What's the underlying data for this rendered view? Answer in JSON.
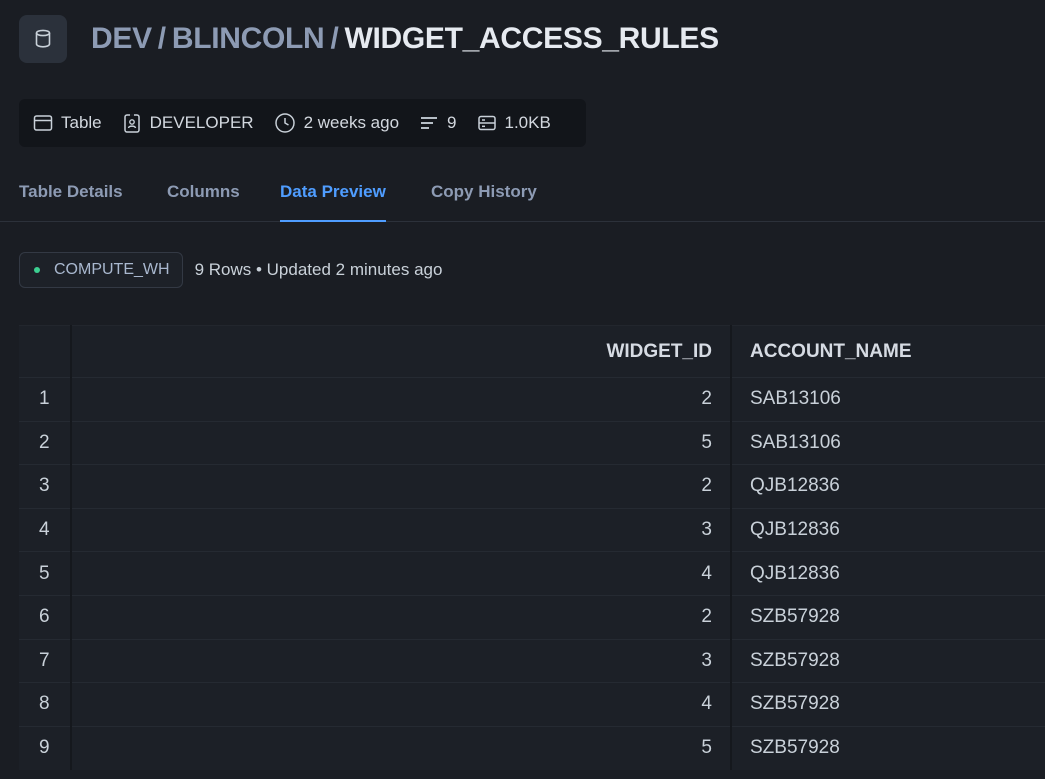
{
  "header": {
    "breadcrumb": [
      "DEV",
      "BLINCOLN"
    ],
    "separator": "/",
    "title": "WIDGET_ACCESS_RULES"
  },
  "meta": {
    "type": "Table",
    "role": "DEVELOPER",
    "modified": "2 weeks ago",
    "rows": "9",
    "size": "1.0KB"
  },
  "tabs": [
    {
      "label": "Table Details",
      "active": false
    },
    {
      "label": "Columns",
      "active": false
    },
    {
      "label": "Data Preview",
      "active": true
    },
    {
      "label": "Copy History",
      "active": false
    }
  ],
  "status": {
    "warehouse": "COMPUTE_WH",
    "summary": "9 Rows • Updated 2 minutes ago",
    "dot_color": "#3ccf91"
  },
  "table": {
    "columns": [
      "",
      "WIDGET_ID",
      "ACCOUNT_NAME"
    ],
    "rows": [
      [
        "1",
        "2",
        "SAB13106"
      ],
      [
        "2",
        "5",
        "SAB13106"
      ],
      [
        "3",
        "2",
        "QJB12836"
      ],
      [
        "4",
        "3",
        "QJB12836"
      ],
      [
        "5",
        "4",
        "QJB12836"
      ],
      [
        "6",
        "2",
        "SZB57928"
      ],
      [
        "7",
        "3",
        "SZB57928"
      ],
      [
        "8",
        "4",
        "SZB57928"
      ],
      [
        "9",
        "5",
        "SZB57928"
      ]
    ]
  },
  "colors": {
    "accent": "#4f9dff",
    "background": "#1a1d23"
  }
}
